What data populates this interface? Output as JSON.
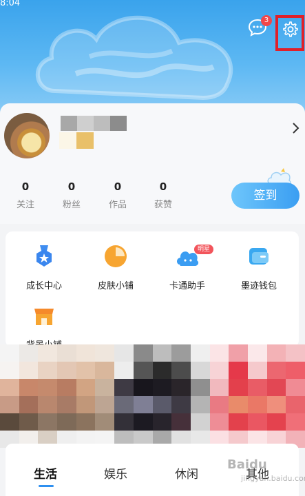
{
  "status": {
    "time": "8:04"
  },
  "header": {
    "message_badge": "3",
    "colors": {
      "bg_top": "#3aa3ec",
      "bg_bottom": "#8cccf6",
      "highlight_box": "#e0202a"
    }
  },
  "profile": {
    "stats": [
      {
        "value": "0",
        "label": "关注"
      },
      {
        "value": "0",
        "label": "粉丝"
      },
      {
        "value": "0",
        "label": "作品"
      },
      {
        "value": "0",
        "label": "获赞"
      }
    ],
    "checkin_label": "签到"
  },
  "services": {
    "items": [
      {
        "label": "成长中心",
        "icon": "growth-medal-icon"
      },
      {
        "label": "皮肤小铺",
        "icon": "skin-shop-icon"
      },
      {
        "label": "卡通助手",
        "icon": "cartoon-assistant-icon"
      },
      {
        "label": "墨迹钱包",
        "icon": "wallet-icon"
      },
      {
        "label": "背景小铺",
        "icon": "background-shop-icon"
      }
    ],
    "cartoon_tag": "明星"
  },
  "tabs": {
    "items": [
      "生活",
      "娱乐",
      "休闲",
      "其他"
    ],
    "active": "生活"
  },
  "watermark": {
    "brand": "Baidu",
    "sub": "jingyan.baidu.com"
  }
}
